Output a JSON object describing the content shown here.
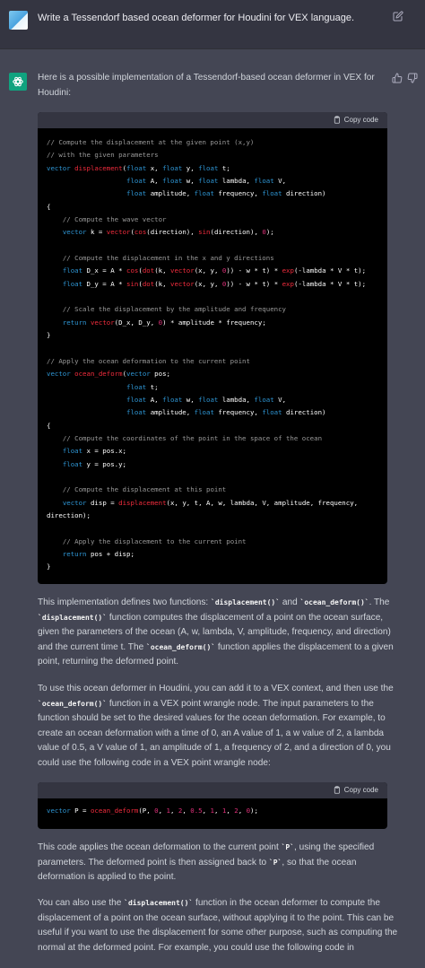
{
  "user_message": {
    "text": "Write a Tessendorf based ocean deformer for Houdini for VEX language.",
    "avatar_icon": "user-avatar",
    "edit_icon": "edit-icon"
  },
  "assistant": {
    "avatar_icon": "openai-logo-icon",
    "feedback_icons": [
      "thumbs-up-icon",
      "thumbs-down-icon"
    ],
    "intro": "Here is a possible implementation of a Tessendorf-based ocean deformer in VEX for Houdini:",
    "copy_label": "Copy code",
    "code_language": "vex",
    "code1": "// Compute the displacement at the given point (x,y)\n// with the given parameters\nvector displacement(float x, float y, float t;\n                    float A, float w, float lambda, float V,\n                    float amplitude, float frequency, float direction)\n{\n    // Compute the wave vector\n    vector k = vector(cos(direction), sin(direction), 0);\n\n    // Compute the displacement in the x and y directions\n    float D_x = A * cos(dot(k, vector(x, y, 0)) - w * t) * exp(-lambda * V * t);\n    float D_y = A * sin(dot(k, vector(x, y, 0)) - w * t) * exp(-lambda * V * t);\n\n    // Scale the displacement by the amplitude and frequency\n    return vector(D_x, D_y, 0) * amplitude * frequency;\n}\n\n// Apply the ocean deformation to the current point\nvector ocean_deform(vector pos;\n                    float t;\n                    float A, float w, float lambda, float V,\n                    float amplitude, float frequency, float direction)\n{\n    // Compute the coordinates of the point in the space of the ocean\n    float x = pos.x;\n    float y = pos.y;\n\n    // Compute the displacement at this point\n    vector disp = displacement(x, y, t, A, w, lambda, V, amplitude, frequency,\ndirection);\n\n    // Apply the displacement to the current point\n    return pos + disp;\n}",
    "p2": [
      {
        "t": "This implementation defines two functions: "
      },
      {
        "c": "`displacement()`"
      },
      {
        "t": " and "
      },
      {
        "c": "`ocean_deform()`"
      },
      {
        "t": ". The "
      },
      {
        "c": "`displacement()`"
      },
      {
        "t": " function computes the displacement of a point on the ocean surface, given the parameters of the ocean (A, w, lambda, V, amplitude, frequency, and direction) and the current time t. The "
      },
      {
        "c": "`ocean_deform()`"
      },
      {
        "t": " function applies the displacement to a given point, returning the deformed point."
      }
    ],
    "p3": [
      {
        "t": "To use this ocean deformer in Houdini, you can add it to a VEX context, and then use the "
      },
      {
        "c": "`ocean_deform()`"
      },
      {
        "t": " function in a VEX point wrangle node. The input parameters to the function should be set to the desired values for the ocean deformation. For example, to create an ocean deformation with a time of 0, an A value of 1, a w value of 2, a lambda value of 0.5, a V value of 1, an amplitude of 1, a frequency of 2, and a direction of 0, you could use the following code in a VEX point wrangle node:"
      }
    ],
    "code2": "vector P = ocean_deform(P, 0, 1, 2, 0.5, 1, 1, 2, 0);",
    "p4": [
      {
        "t": "This code applies the ocean deformation to the current point "
      },
      {
        "c": "`P`"
      },
      {
        "t": ", using the specified parameters. The deformed point is then assigned back to "
      },
      {
        "c": "`P`"
      },
      {
        "t": ", so that the ocean deformation is applied to the point."
      }
    ],
    "p5": [
      {
        "t": "You can also use the "
      },
      {
        "c": "`displacement()`"
      },
      {
        "t": " function in the ocean deformer to compute the displacement of a point on the ocean surface, without applying it to the point. This can be useful if you want to use the displacement for some other purpose, such as computing the normal at the deformed point. For example, you could use the following code in"
      }
    ]
  },
  "colors": {
    "page_bg": "#444654",
    "user_bg": "#343541",
    "code_bg": "#000000",
    "code_header_bg": "#343541",
    "accent_green": "#10a37f",
    "keyword": "#2e95d3",
    "function": "#f22c3d",
    "number": "#df3079",
    "comment": "#9a9a9a"
  }
}
